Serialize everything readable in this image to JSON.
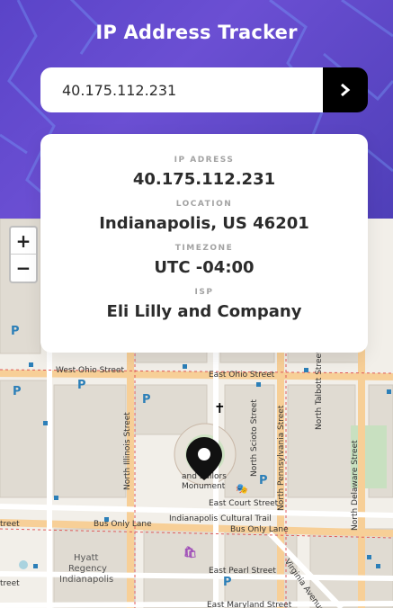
{
  "header": {
    "title": "IP Address Tracker",
    "search": {
      "value": "40.175.112.231",
      "submit_icon": "chevron-right-icon"
    }
  },
  "card": {
    "ip": {
      "label": "IP ADRESS",
      "value": "40.175.112.231"
    },
    "location": {
      "label": "LOCATION",
      "value": "Indianapolis, US 46201"
    },
    "timezone": {
      "label": "TIMEZONE",
      "value": "UTC -04:00"
    },
    "isp": {
      "label": "ISP",
      "value": "Eli Lilly and Company"
    }
  },
  "map": {
    "zoom_in": "+",
    "zoom_out": "−",
    "streets": {
      "west_ohio": "West Ohio Street",
      "east_ohio": "East Ohio Street",
      "north_illinois": "North Illinois Street",
      "north_scioto": "North Scioto Street",
      "north_pennsylvania": "North Pennsylvania Street",
      "north_talbott": "North Talbott Street",
      "north_delaware": "North Delaware Street",
      "east_court": "East Court Street",
      "bus_only_1": "Bus Only Lane",
      "bus_only_2": "Bus Only Lane",
      "cultural_trail": "Indianapolis Cultural Trail",
      "east_pearl": "East Pearl Street",
      "virginia": "Virginia Avenue",
      "east_maryland": "East Maryland Street",
      "street_left_1": "treet",
      "street_left_2": "treet"
    },
    "places": {
      "monument_line1": "and Sailors",
      "monument_line2": "Monument",
      "hyatt_1": "Hyatt",
      "hyatt_2": "Regency",
      "hyatt_3": "Indianapolis"
    },
    "parking_symbol": "P",
    "marker_icon": "location-pin-icon",
    "colors": {
      "accent": "#5a44c8",
      "parking": "#2c7fb8"
    }
  }
}
